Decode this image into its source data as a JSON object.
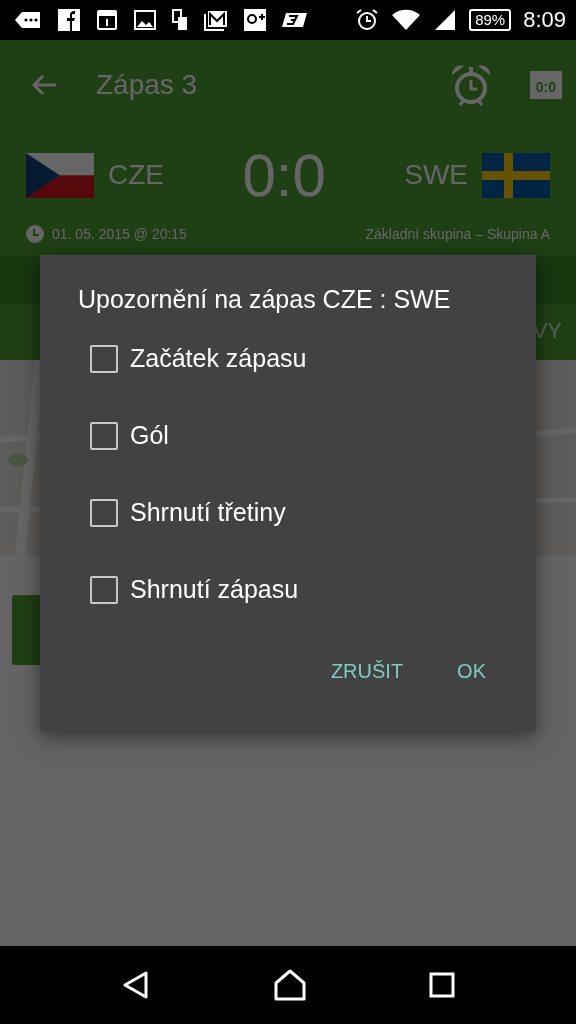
{
  "status_bar": {
    "battery": "89%",
    "time": "8:09"
  },
  "app_bar": {
    "title": "Zápas 3",
    "score_icon_text": "0:0"
  },
  "match": {
    "home": {
      "code": "CZE"
    },
    "away": {
      "code": "SWE"
    },
    "score": "0:0",
    "datetime": "01. 05. 2015  @ 20:15",
    "stage": "Základní skupina – Skupina A"
  },
  "tabs": [
    {
      "label": "VY",
      "selected": false
    }
  ],
  "dialog": {
    "title": "Upozornění na zápas CZE : SWE",
    "options": [
      {
        "label": "Začátek zápasu",
        "checked": false
      },
      {
        "label": "Gól",
        "checked": false
      },
      {
        "label": "Shrnutí třetiny",
        "checked": false
      },
      {
        "label": "Shrnutí zápasu",
        "checked": false
      }
    ],
    "buttons": [
      "ZRUŠIT",
      "OK"
    ]
  }
}
